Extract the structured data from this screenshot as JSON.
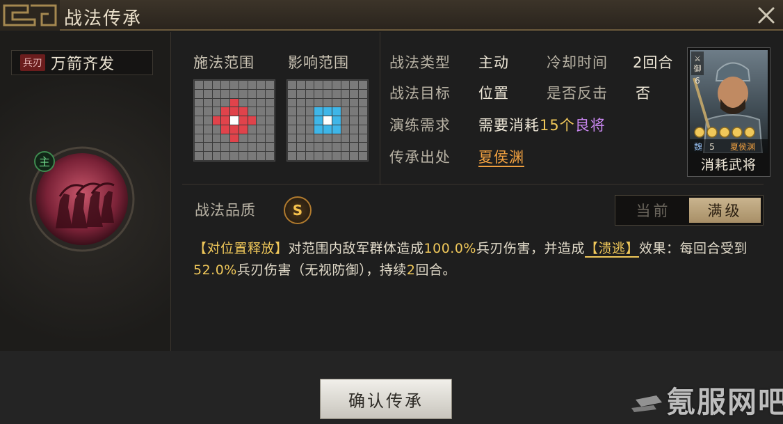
{
  "window": {
    "title": "战法传承",
    "close_icon": "close-icon"
  },
  "skill": {
    "type_badge": "兵刃",
    "name": "万箭齐发",
    "emblem_badge": "主",
    "emblem_icon": "archers-volley-icon"
  },
  "range": {
    "cast_label": "施法范围",
    "effect_label": "影响范围",
    "cast_color": "#e0434b",
    "effect_color": "#3fb6e8"
  },
  "info": {
    "rows": [
      {
        "label": "战法类型",
        "value": "主动"
      },
      {
        "label": "战法目标",
        "value": "位置"
      },
      {
        "label": "演练需求",
        "value_prefix": "需要消耗",
        "value_num": "15个",
        "value_grade": "良将"
      },
      {
        "label": "传承出处",
        "value": "夏侯渊"
      }
    ],
    "cooldown_label": "冷却时间",
    "cooldown_value": "2回合",
    "counter_label": "是否反击",
    "counter_value": "否"
  },
  "general_card": {
    "unit_type": "御",
    "cost": "6",
    "faction": "魏",
    "level": "5",
    "name": "夏侯渊",
    "stars": 5,
    "caption": "消耗武将"
  },
  "quality": {
    "label": "战法品质",
    "grade": "S"
  },
  "toggle": {
    "current_label": "当前",
    "max_label": "满级",
    "selected": "满级"
  },
  "description": {
    "tag1": "【对位置释放】",
    "text1": "对范围内敌军群体造成",
    "num1": "100.0%",
    "text2": "兵刃伤害，并造成",
    "tag2": "【溃逃】",
    "text3": "效果：每回合受到",
    "num2": "52.0%",
    "text4": "兵刃伤害（无视防御），持续",
    "num3": "2",
    "text5": "回合。"
  },
  "footer": {
    "confirm_label": "确认传承",
    "watermark": "氪服网吧"
  },
  "colors": {
    "accent_gold": "#f0c85a",
    "grade_purple": "#c987f0",
    "link_orange": "#f0a040"
  }
}
